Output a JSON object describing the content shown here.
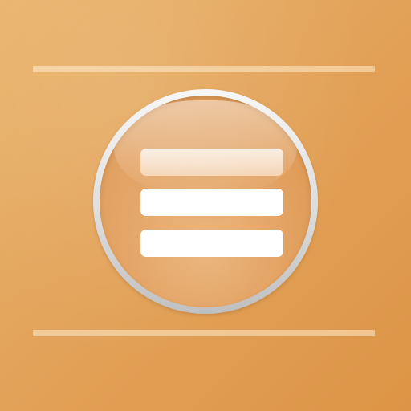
{
  "icon": {
    "name": "menu-app-icon",
    "symbol": "hamburger-menu-icon",
    "colors": {
      "background_light": "#e8b46b",
      "background_dark": "#dd9445",
      "rule": "#f3d3a6",
      "ring": "#e0e0e0",
      "face": "#e3a160",
      "bar": "#ffffff"
    }
  }
}
